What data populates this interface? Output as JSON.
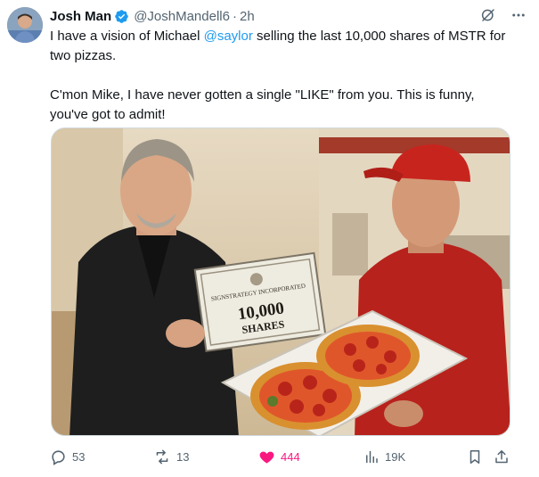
{
  "author": {
    "name": "Josh Man",
    "handle": "@JoshMandell6",
    "separator": "·",
    "time": "2h",
    "verified": true
  },
  "text": {
    "line1_pre": "I have a vision of Michael ",
    "line1_mention": "@saylor",
    "line1_post": " selling the last 10,000 shares of MSTR for two pizzas.",
    "line2": "C'mon Mike, I have never gotten a single \"LIKE\" from you.   This is funny, you've got to admit!"
  },
  "media": {
    "certificate_header": "SIGNSTRATEGY INCORPORATED",
    "certificate_value": "10,000",
    "certificate_unit": "SHARES"
  },
  "actions": {
    "replies": "53",
    "reposts": "13",
    "likes": "444",
    "views": "19K"
  },
  "colors": {
    "accent": "#1d9bf0",
    "like": "#f91880",
    "muted": "#536471"
  },
  "icons": [
    "verified-badge-icon",
    "grok-icon",
    "more-icon",
    "reply-icon",
    "repost-icon",
    "heart-icon",
    "views-icon",
    "bookmark-icon",
    "share-icon"
  ]
}
